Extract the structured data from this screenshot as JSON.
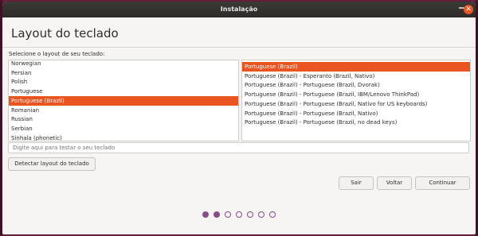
{
  "window": {
    "title": "Instalação"
  },
  "page": {
    "heading": "Layout do teclado",
    "prompt": "Selecione o layout de seu teclado:"
  },
  "layouts": [
    {
      "label": "Norwegian"
    },
    {
      "label": "Persian"
    },
    {
      "label": "Polish"
    },
    {
      "label": "Portuguese"
    },
    {
      "label": "Portuguese (Brazil)"
    },
    {
      "label": "Romanian"
    },
    {
      "label": "Russian"
    },
    {
      "label": "Serbian"
    },
    {
      "label": "Sinhala (phonetic)"
    }
  ],
  "selected_layout": "Portuguese (Brazil)",
  "variants": [
    {
      "label": "Portuguese (Brazil)"
    },
    {
      "label": "Portuguese (Brazil) - Esperanto (Brazil, Nativo)"
    },
    {
      "label": "Portuguese (Brazil) - Portuguese (Brazil, Dvorak)"
    },
    {
      "label": "Portuguese (Brazil) - Portuguese (Brazil, IBM/Lenovo ThinkPad)"
    },
    {
      "label": "Portuguese (Brazil) - Portuguese (Brazil, Nativo for US keyboards)"
    },
    {
      "label": "Portuguese (Brazil) - Portuguese (Brazil, Nativo)"
    },
    {
      "label": "Portuguese (Brazil) - Portuguese (Brazil, no dead keys)"
    }
  ],
  "selected_variant": "Portuguese (Brazil)",
  "test_input": {
    "placeholder": "Digite aqui para testar o seu teclado",
    "value": ""
  },
  "buttons": {
    "detect": "Detectar layout do teclado",
    "quit": "Sair",
    "back": "Voltar",
    "continue": "Continuar"
  },
  "progress": {
    "total_steps": 7,
    "current_step": 2
  },
  "colors": {
    "accent": "#e95420",
    "progress": "#8a4c86"
  }
}
